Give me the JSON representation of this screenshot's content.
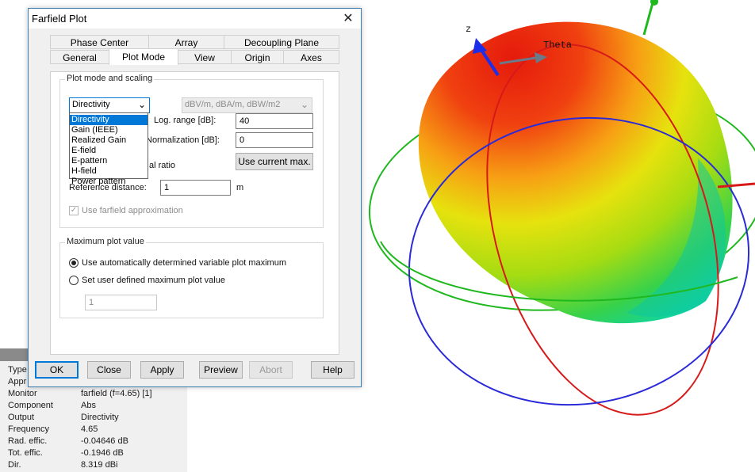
{
  "plot": {
    "axis_z_label": "z",
    "axis_theta_label": "Theta",
    "colors": {
      "ring_green": "#1fb81f",
      "ring_red": "#d61a1a",
      "ring_blue": "#2a2ad8",
      "axis_blue": "#1c2ee8"
    }
  },
  "info_panel": {
    "rows": [
      {
        "key": "Type",
        "value": ""
      },
      {
        "key": "Appr",
        "value": ""
      },
      {
        "key": "Monitor",
        "value": "farfield (f=4.65) [1]"
      },
      {
        "key": "Component",
        "value": "Abs"
      },
      {
        "key": "Output",
        "value": "Directivity"
      },
      {
        "key": "Frequency",
        "value": "4.65"
      },
      {
        "key": "Rad. effic.",
        "value": "-0.04646 dB"
      },
      {
        "key": "Tot. effic.",
        "value": "-0.1946 dB"
      },
      {
        "key": "Dir.",
        "value": "8.319 dBi"
      }
    ]
  },
  "dialog": {
    "title": "Farfield Plot",
    "close_glyph": "✕",
    "tabs_row1": [
      "Phase Center",
      "Array",
      "Decoupling Plane"
    ],
    "tabs_row2": [
      "General",
      "Plot Mode",
      "View",
      "Origin",
      "Axes"
    ],
    "active_tab": "Plot Mode",
    "scaling_group": {
      "title": "Plot mode and scaling",
      "mode_selected": "Directivity",
      "mode_options": [
        "Directivity",
        "Gain (IEEE)",
        "Realized Gain",
        "E-field",
        "E-pattern",
        "H-field",
        "Power pattern"
      ],
      "unit_select": "dBV/m, dBA/m, dBW/m2",
      "log_range_label": "Log. range [dB]:",
      "log_range_value": "40",
      "normalization_label": "Normalization [dB]:",
      "normalization_value": "0",
      "axial_ratio_label": "al ratio",
      "use_current_max_label": "Use current max.",
      "reference_distance_label": "Reference distance:",
      "reference_distance_value": "1",
      "reference_distance_unit": "m",
      "farfield_approx_label": "Use farfield approximation"
    },
    "max_group": {
      "title": "Maximum plot value",
      "auto_label": "Use automatically determined variable plot maximum",
      "user_label": "Set user defined maximum plot value",
      "user_value": "1"
    },
    "buttons": {
      "ok": "OK",
      "close": "Close",
      "apply": "Apply",
      "preview": "Preview",
      "abort": "Abort",
      "help": "Help"
    }
  }
}
